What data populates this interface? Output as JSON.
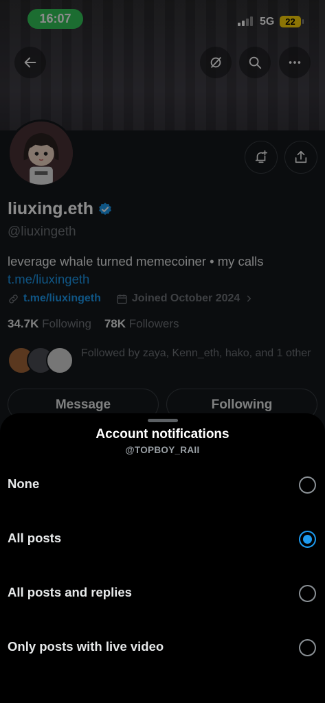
{
  "status_bar": {
    "time": "16:07",
    "network": "5G",
    "battery": "22"
  },
  "profile": {
    "name": "liuxing.eth",
    "handle": "@liuxingeth",
    "bio_text": "leverage whale turned memecoiner • my calls",
    "bio_link": "t.me/liuxingeth",
    "website": "t.me/liuxingeth",
    "joined": "Joined October 2024",
    "following_count": "34.7K",
    "following_label": "Following",
    "followers_count": "78K",
    "followers_label": "Followers",
    "followed_by": "Followed by zaya, Kenn_eth, hako, and 1 other",
    "message_button": "Message",
    "following_button": "Following",
    "accent_color": "#1d9bf0"
  },
  "sheet": {
    "title": "Account notifications",
    "subtitle": "@TOPBOY_RAII",
    "options": [
      {
        "label": "None",
        "selected": false
      },
      {
        "label": "All posts",
        "selected": true
      },
      {
        "label": "All posts and replies",
        "selected": false
      },
      {
        "label": "Only posts with live video",
        "selected": false
      }
    ]
  }
}
